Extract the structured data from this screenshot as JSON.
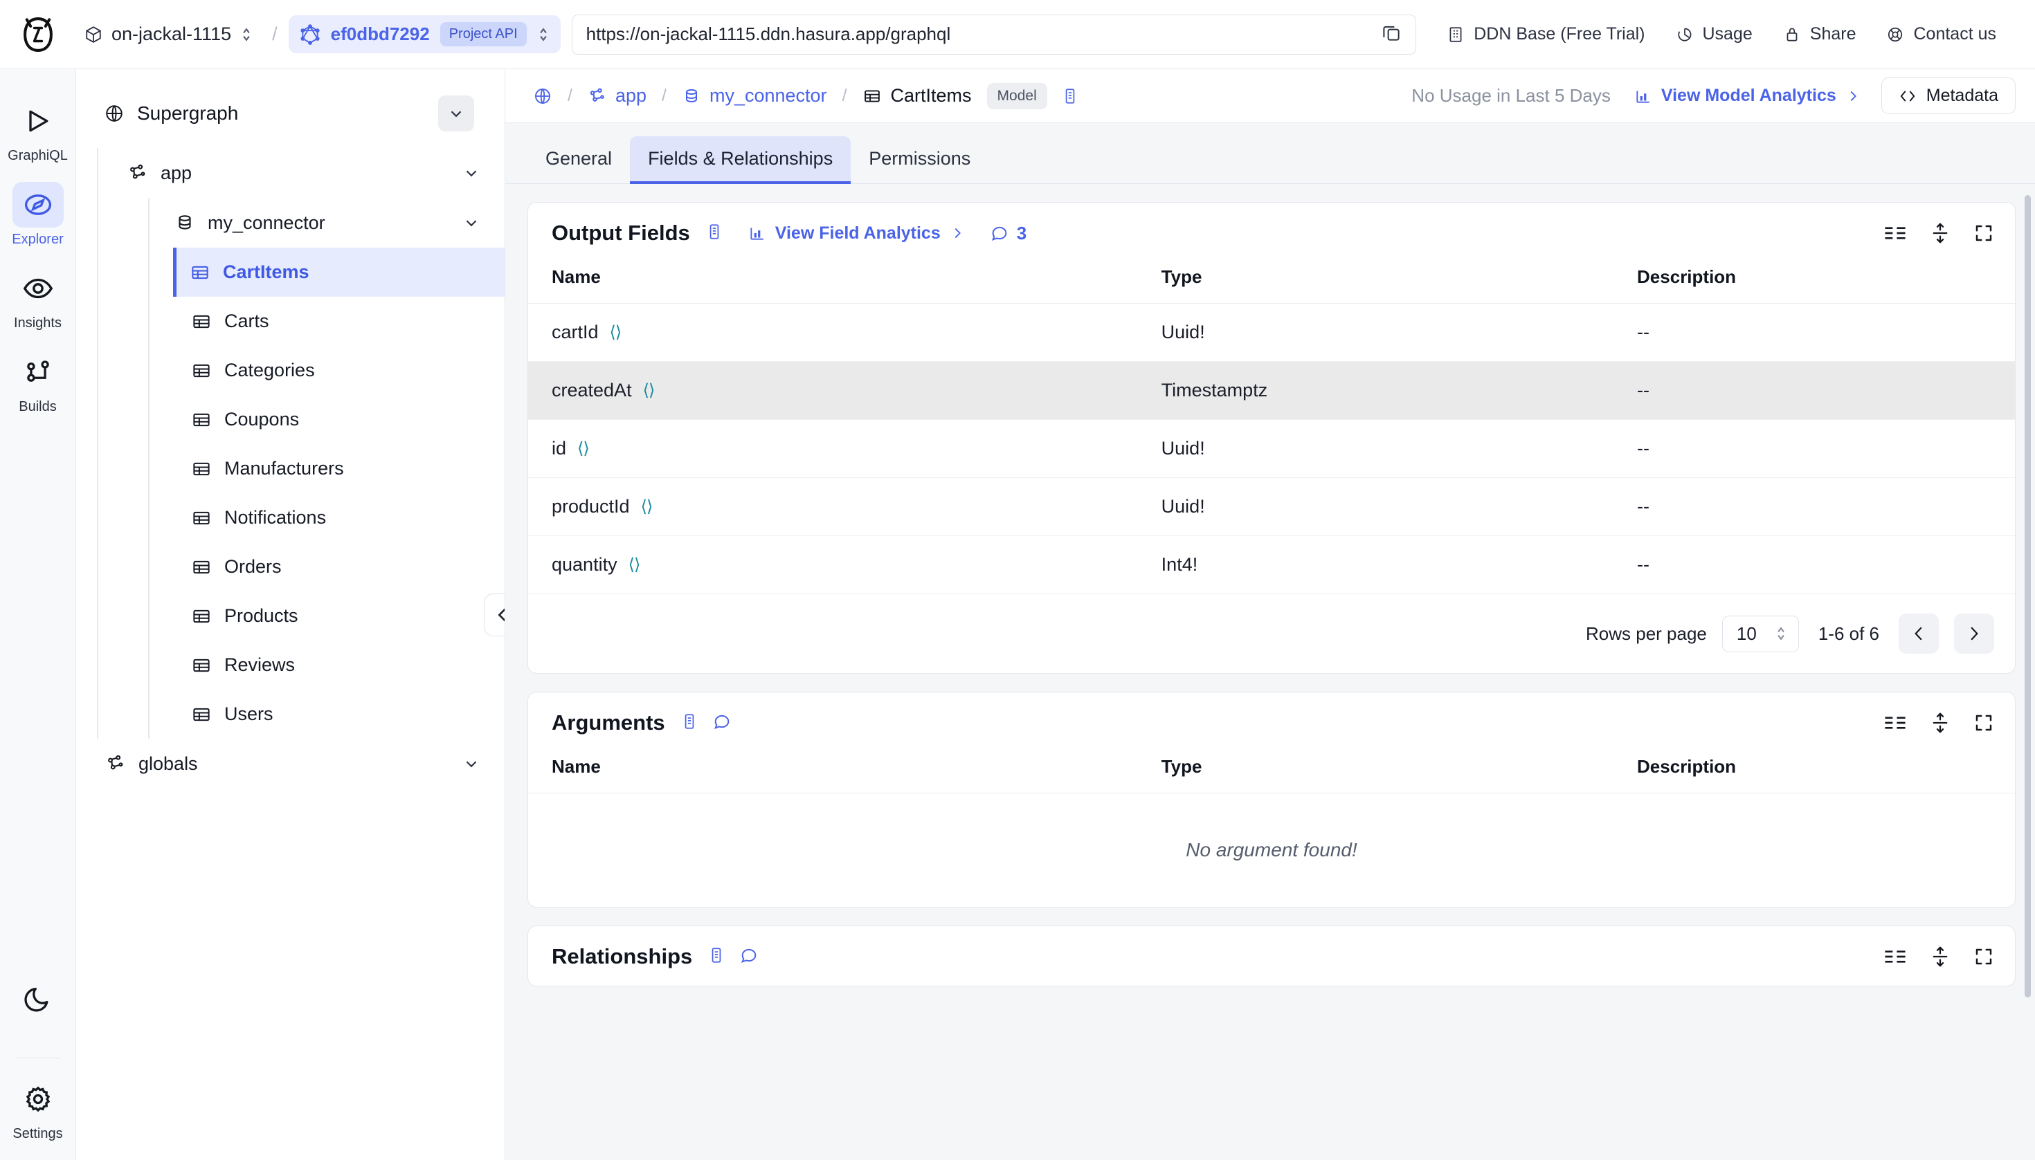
{
  "topbar": {
    "logo": "hasura-logo",
    "project_name": "on-jackal-1115",
    "api_id": "ef0dbd7292",
    "api_tag": "Project API",
    "url": "https://on-jackal-1115.ddn.hasura.app/graphql",
    "copy_icon": "copy-icon",
    "right_items": [
      {
        "label": "DDN Base (Free Trial)",
        "icon": "building-icon"
      },
      {
        "label": "Usage",
        "icon": "usage-icon"
      },
      {
        "label": "Share",
        "icon": "lock-icon"
      },
      {
        "label": "Contact us",
        "icon": "support-icon"
      }
    ]
  },
  "rail": {
    "items": [
      {
        "label": "GraphiQL",
        "icon": "play-icon",
        "active": false
      },
      {
        "label": "Explorer",
        "icon": "compass-icon",
        "active": true
      },
      {
        "label": "Insights",
        "icon": "eye-icon",
        "active": false
      },
      {
        "label": "Builds",
        "icon": "builds-icon",
        "active": false
      }
    ],
    "theme_toggle": "moon-icon",
    "settings": {
      "label": "Settings",
      "icon": "gear-icon"
    }
  },
  "tree": {
    "root": {
      "label": "Supergraph",
      "icon": "globe-icon"
    },
    "subgraph": {
      "label": "app",
      "icon": "subgraph-icon"
    },
    "connector": {
      "label": "my_connector",
      "icon": "database-icon"
    },
    "models": [
      {
        "label": "CartItems",
        "selected": true
      },
      {
        "label": "Carts",
        "selected": false
      },
      {
        "label": "Categories",
        "selected": false
      },
      {
        "label": "Coupons",
        "selected": false
      },
      {
        "label": "Manufacturers",
        "selected": false
      },
      {
        "label": "Notifications",
        "selected": false
      },
      {
        "label": "Orders",
        "selected": false
      },
      {
        "label": "Products",
        "selected": false
      },
      {
        "label": "Reviews",
        "selected": false
      },
      {
        "label": "Users",
        "selected": false
      }
    ],
    "globals": {
      "label": "globals",
      "icon": "subgraph-icon"
    },
    "collapse_icon": "chevrons-left-icon"
  },
  "main_header": {
    "breadcrumb": [
      {
        "label": "",
        "icon": "globe-icon"
      },
      {
        "label": "app",
        "icon": "subgraph-icon"
      },
      {
        "label": "my_connector",
        "icon": "database-icon"
      },
      {
        "label": "CartItems",
        "icon": "table-icon"
      }
    ],
    "type_badge": "Model",
    "doc_icon": "doc-icon",
    "usage_status": "No Usage in Last 5 Days",
    "analytics_link": "View Model Analytics",
    "metadata_button": "Metadata"
  },
  "tabs": [
    {
      "label": "General",
      "active": false
    },
    {
      "label": "Fields & Relationships",
      "active": true
    },
    {
      "label": "Permissions",
      "active": false
    }
  ],
  "output_fields": {
    "title": "Output Fields",
    "doc_icon": "doc-icon",
    "analytics_link": "View Field Analytics",
    "comment_count": "3",
    "columns": [
      "Name",
      "Type",
      "Description"
    ],
    "rows": [
      {
        "name": "cartId",
        "type": "Uuid!",
        "description": "--",
        "highlighted": false
      },
      {
        "name": "createdAt",
        "type": "Timestamptz",
        "description": "--",
        "highlighted": true
      },
      {
        "name": "id",
        "type": "Uuid!",
        "description": "--",
        "highlighted": false
      },
      {
        "name": "productId",
        "type": "Uuid!",
        "description": "--",
        "highlighted": false
      },
      {
        "name": "quantity",
        "type": "Int4!",
        "description": "--",
        "highlighted": false
      }
    ],
    "pagination": {
      "rows_per_page_label": "Rows per page",
      "rows_per_page_value": "10",
      "range": "1-6 of 6"
    }
  },
  "arguments": {
    "title": "Arguments",
    "doc_icon": "doc-icon",
    "comment_icon": "comment-icon",
    "columns": [
      "Name",
      "Type",
      "Description"
    ],
    "empty_message": "No argument found!"
  },
  "relationships": {
    "title": "Relationships"
  },
  "colors": {
    "accent": "#4a63e7",
    "accent_soft": "#e6ebfd",
    "code_icon": "#1b8a9e",
    "row_highlight": "#eaeaea",
    "page_bg": "#f5f6f8"
  }
}
